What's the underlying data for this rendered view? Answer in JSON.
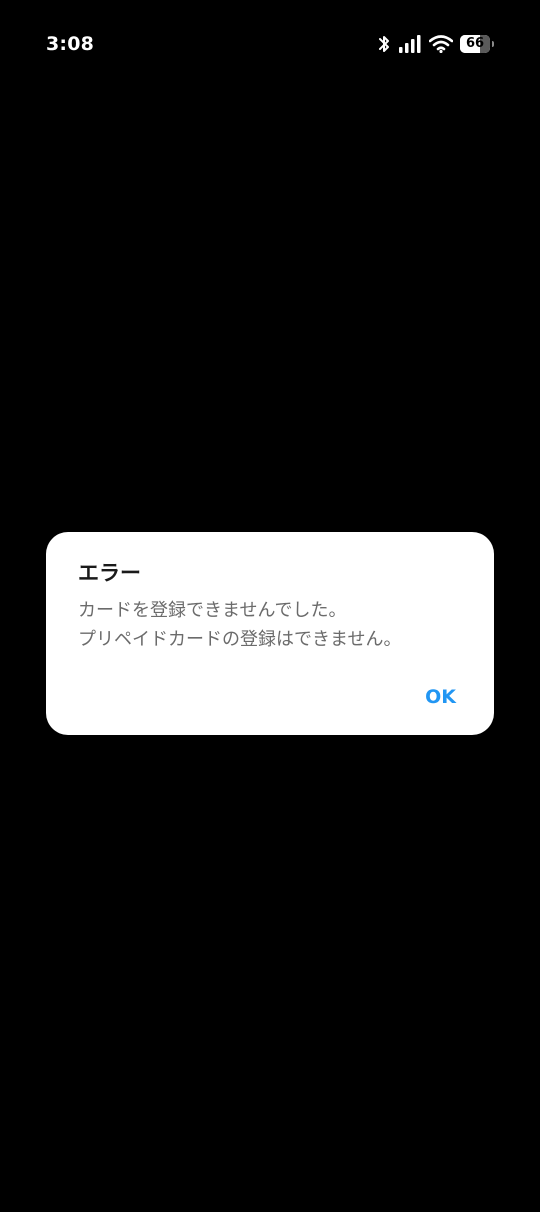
{
  "status_bar": {
    "time": "3:08",
    "battery_level": "66",
    "battery_fraction": 0.66,
    "icons": [
      "bluetooth-icon",
      "signal-icon",
      "wifi-icon",
      "battery-icon"
    ]
  },
  "dialog": {
    "title": "エラー",
    "message_lines": [
      "カードを登録できませんでした。",
      "プリペイドカードの登録はできません。"
    ],
    "ok_label": "OK"
  },
  "colors": {
    "background": "#000000",
    "dialog_background": "#ffffff",
    "accent": "#2196f3",
    "title_text": "#1a1a1a",
    "message_text": "#6b6b6b"
  }
}
